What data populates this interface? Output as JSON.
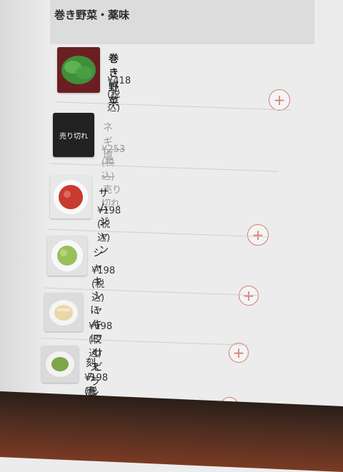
{
  "section": {
    "title": "巻き野菜・薬味"
  },
  "items": [
    {
      "name": "巻き野菜",
      "price": "¥418 (税込)",
      "sold_out": false
    },
    {
      "name": "ネギ塩",
      "price": "¥253 (税込)",
      "sold_out": true,
      "sold_out_badge": "売り切れ",
      "sold_out_label": "売り切れ"
    },
    {
      "name": "サムジャン",
      "price": "¥198 (税込)",
      "sold_out": false
    },
    {
      "name": "シャキシャキワサビ",
      "price": "¥198 (税込)",
      "sold_out": false
    },
    {
      "name": "にんにくスライス",
      "price": "¥198 (税込)",
      "sold_out": false
    },
    {
      "name": "刻み唐辛子",
      "price": "¥198 (税込)",
      "sold_out": false
    }
  ],
  "add_button": {
    "symbol": "+"
  },
  "colors": {
    "accent": "#d87a6f"
  }
}
